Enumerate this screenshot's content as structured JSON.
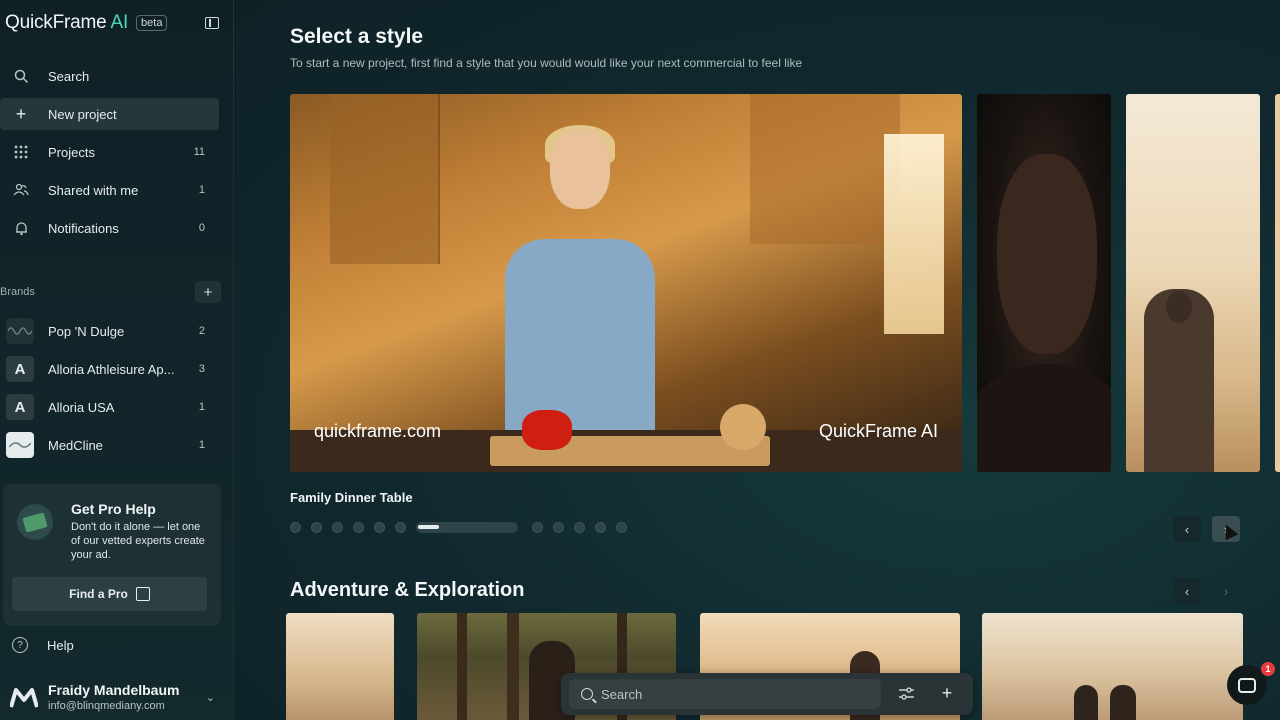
{
  "app": {
    "logo_text": "QuickFrame",
    "logo_ai": "AI",
    "badge": "beta"
  },
  "nav": [
    {
      "label": "Search",
      "icon": "search-icon",
      "count": ""
    },
    {
      "label": "New project",
      "icon": "plus-icon",
      "count": "",
      "active": true
    },
    {
      "label": "Projects",
      "icon": "grid-icon",
      "count": "11"
    },
    {
      "label": "Shared with me",
      "icon": "people-icon",
      "count": "1"
    },
    {
      "label": "Notifications",
      "icon": "bell-icon",
      "count": "0"
    }
  ],
  "brands": {
    "heading": "Brands",
    "items": [
      {
        "name": "Pop 'N Dulge",
        "logo": "",
        "count": "2"
      },
      {
        "name": "Alloria Athleisure Ap...",
        "logo": "A",
        "count": "3"
      },
      {
        "name": "Alloria USA",
        "logo": "A",
        "count": "1"
      },
      {
        "name": "MedCline",
        "logo": "",
        "count": "1"
      }
    ]
  },
  "pro_help": {
    "title": "Get Pro Help",
    "text": "Don't do it alone — let one of our vetted experts create your ad.",
    "button": "Find a Pro"
  },
  "help": {
    "label": "Help"
  },
  "user": {
    "name": "Fraidy Mandelbaum",
    "email": "info@blinqmediany.com"
  },
  "main": {
    "title": "Select a style",
    "subtitle": "To start a new project, first find a style that you would would like your next commercial to feel like",
    "featured": {
      "caption": "Family Dinner Table",
      "watermark_left": "quickframe.com",
      "watermark_right": "QuickFrame AI",
      "slide_count": 12,
      "active_slide": 7,
      "active_progress": 0.21
    },
    "section_title": "Adventure & Exploration"
  },
  "searchbar": {
    "placeholder": "Search"
  },
  "chat": {
    "badge": "1"
  },
  "colors": {
    "accent": "#4fd6b8",
    "background": "#0f2126",
    "badge_red": "#e23c3c"
  }
}
